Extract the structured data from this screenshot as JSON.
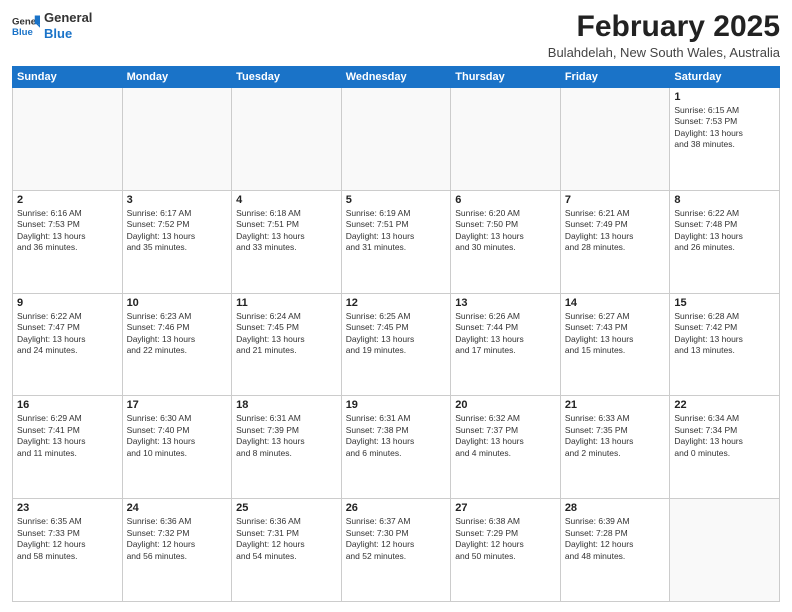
{
  "header": {
    "logo_line1": "General",
    "logo_line2": "Blue",
    "month_year": "February 2025",
    "location": "Bulahdelah, New South Wales, Australia"
  },
  "days_of_week": [
    "Sunday",
    "Monday",
    "Tuesday",
    "Wednesday",
    "Thursday",
    "Friday",
    "Saturday"
  ],
  "weeks": [
    [
      {
        "day": "",
        "info": ""
      },
      {
        "day": "",
        "info": ""
      },
      {
        "day": "",
        "info": ""
      },
      {
        "day": "",
        "info": ""
      },
      {
        "day": "",
        "info": ""
      },
      {
        "day": "",
        "info": ""
      },
      {
        "day": "1",
        "info": "Sunrise: 6:15 AM\nSunset: 7:53 PM\nDaylight: 13 hours\nand 38 minutes."
      }
    ],
    [
      {
        "day": "2",
        "info": "Sunrise: 6:16 AM\nSunset: 7:53 PM\nDaylight: 13 hours\nand 36 minutes."
      },
      {
        "day": "3",
        "info": "Sunrise: 6:17 AM\nSunset: 7:52 PM\nDaylight: 13 hours\nand 35 minutes."
      },
      {
        "day": "4",
        "info": "Sunrise: 6:18 AM\nSunset: 7:51 PM\nDaylight: 13 hours\nand 33 minutes."
      },
      {
        "day": "5",
        "info": "Sunrise: 6:19 AM\nSunset: 7:51 PM\nDaylight: 13 hours\nand 31 minutes."
      },
      {
        "day": "6",
        "info": "Sunrise: 6:20 AM\nSunset: 7:50 PM\nDaylight: 13 hours\nand 30 minutes."
      },
      {
        "day": "7",
        "info": "Sunrise: 6:21 AM\nSunset: 7:49 PM\nDaylight: 13 hours\nand 28 minutes."
      },
      {
        "day": "8",
        "info": "Sunrise: 6:22 AM\nSunset: 7:48 PM\nDaylight: 13 hours\nand 26 minutes."
      }
    ],
    [
      {
        "day": "9",
        "info": "Sunrise: 6:22 AM\nSunset: 7:47 PM\nDaylight: 13 hours\nand 24 minutes."
      },
      {
        "day": "10",
        "info": "Sunrise: 6:23 AM\nSunset: 7:46 PM\nDaylight: 13 hours\nand 22 minutes."
      },
      {
        "day": "11",
        "info": "Sunrise: 6:24 AM\nSunset: 7:45 PM\nDaylight: 13 hours\nand 21 minutes."
      },
      {
        "day": "12",
        "info": "Sunrise: 6:25 AM\nSunset: 7:45 PM\nDaylight: 13 hours\nand 19 minutes."
      },
      {
        "day": "13",
        "info": "Sunrise: 6:26 AM\nSunset: 7:44 PM\nDaylight: 13 hours\nand 17 minutes."
      },
      {
        "day": "14",
        "info": "Sunrise: 6:27 AM\nSunset: 7:43 PM\nDaylight: 13 hours\nand 15 minutes."
      },
      {
        "day": "15",
        "info": "Sunrise: 6:28 AM\nSunset: 7:42 PM\nDaylight: 13 hours\nand 13 minutes."
      }
    ],
    [
      {
        "day": "16",
        "info": "Sunrise: 6:29 AM\nSunset: 7:41 PM\nDaylight: 13 hours\nand 11 minutes."
      },
      {
        "day": "17",
        "info": "Sunrise: 6:30 AM\nSunset: 7:40 PM\nDaylight: 13 hours\nand 10 minutes."
      },
      {
        "day": "18",
        "info": "Sunrise: 6:31 AM\nSunset: 7:39 PM\nDaylight: 13 hours\nand 8 minutes."
      },
      {
        "day": "19",
        "info": "Sunrise: 6:31 AM\nSunset: 7:38 PM\nDaylight: 13 hours\nand 6 minutes."
      },
      {
        "day": "20",
        "info": "Sunrise: 6:32 AM\nSunset: 7:37 PM\nDaylight: 13 hours\nand 4 minutes."
      },
      {
        "day": "21",
        "info": "Sunrise: 6:33 AM\nSunset: 7:35 PM\nDaylight: 13 hours\nand 2 minutes."
      },
      {
        "day": "22",
        "info": "Sunrise: 6:34 AM\nSunset: 7:34 PM\nDaylight: 13 hours\nand 0 minutes."
      }
    ],
    [
      {
        "day": "23",
        "info": "Sunrise: 6:35 AM\nSunset: 7:33 PM\nDaylight: 12 hours\nand 58 minutes."
      },
      {
        "day": "24",
        "info": "Sunrise: 6:36 AM\nSunset: 7:32 PM\nDaylight: 12 hours\nand 56 minutes."
      },
      {
        "day": "25",
        "info": "Sunrise: 6:36 AM\nSunset: 7:31 PM\nDaylight: 12 hours\nand 54 minutes."
      },
      {
        "day": "26",
        "info": "Sunrise: 6:37 AM\nSunset: 7:30 PM\nDaylight: 12 hours\nand 52 minutes."
      },
      {
        "day": "27",
        "info": "Sunrise: 6:38 AM\nSunset: 7:29 PM\nDaylight: 12 hours\nand 50 minutes."
      },
      {
        "day": "28",
        "info": "Sunrise: 6:39 AM\nSunset: 7:28 PM\nDaylight: 12 hours\nand 48 minutes."
      },
      {
        "day": "",
        "info": ""
      }
    ]
  ]
}
